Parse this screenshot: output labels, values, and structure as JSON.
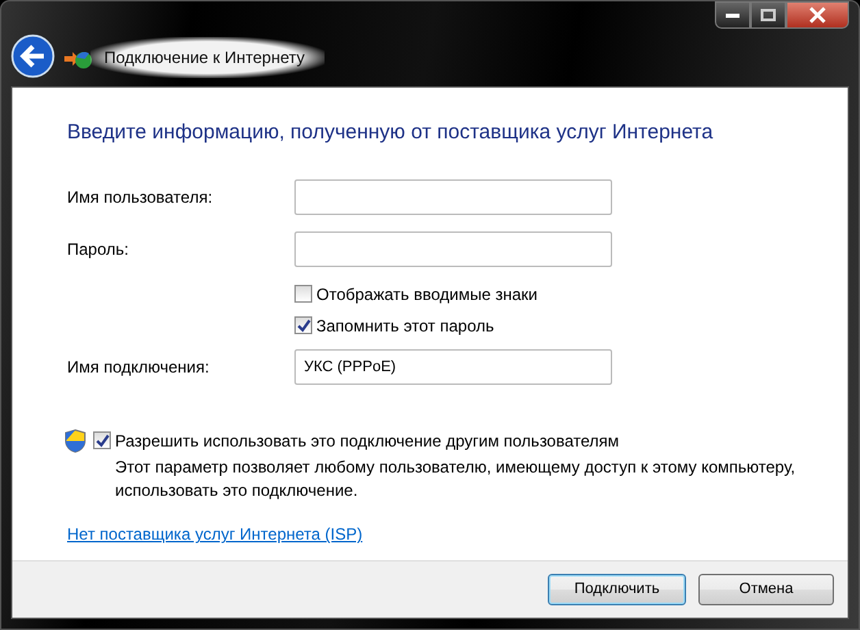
{
  "window": {
    "title": "Подключение к Интернету"
  },
  "heading": "Введите информацию, полученную от поставщика услуг Интернета",
  "fields": [
    {
      "label": "Имя пользователя:"
    },
    {
      "label": "Пароль:"
    }
  ],
  "options": [
    {
      "label": "Отображать вводимые знаки",
      "checked": false
    },
    {
      "label": "Запомнить этот пароль",
      "checked": true
    }
  ],
  "connection_name": {
    "label": "Имя подключения:",
    "value": "УКС (PPPoE)"
  },
  "share": {
    "label": "Разрешить использовать это подключение другим пользователям",
    "checked": true,
    "description": "Этот параметр позволяет любому пользователю, имеющему доступ к этому компьютеру, использовать это подключение."
  },
  "link": "Нет поставщика услуг Интернета (ISP)",
  "buttons": [
    {
      "label": "Подключить",
      "kind": "default"
    },
    {
      "label": "Отмена",
      "kind": "normal"
    }
  ]
}
